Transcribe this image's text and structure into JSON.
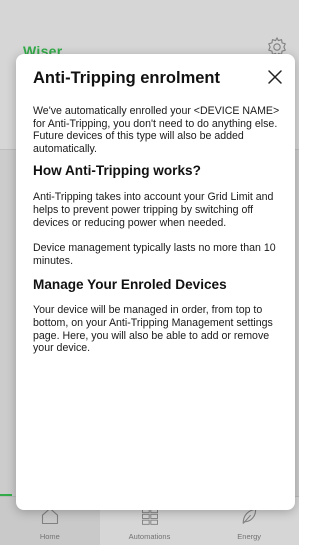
{
  "app": {
    "logo_text": "Wiser",
    "nav": [
      {
        "label": "Home",
        "icon": "home-icon"
      },
      {
        "label": "Automations",
        "icon": "grid-icon"
      },
      {
        "label": "Energy",
        "icon": "leaf-icon"
      }
    ],
    "accent_color": "#3dcd58"
  },
  "dialog": {
    "title": "Anti-Tripping enrolment",
    "intro": "We've automatically enrolled your <DEVICE NAME> for Anti-Tripping, you don't need to do anything else. Future devices of this type will also be added automatically.",
    "section1_heading": "How Anti-Tripping works?",
    "section1_para1": "Anti-Tripping takes into account your Grid Limit and helps to prevent power tripping by switching off devices or reducing power when needed.",
    "section1_para2": "Device management typically lasts no more than 10 minutes.",
    "section2_heading": "Manage Your Enroled Devices",
    "section2_para": "Your device will be managed in order, from top to bottom, on your Anti-Tripping Management settings page. Here, you will also be able to add or remove your device.",
    "close_icon": "close-icon"
  }
}
